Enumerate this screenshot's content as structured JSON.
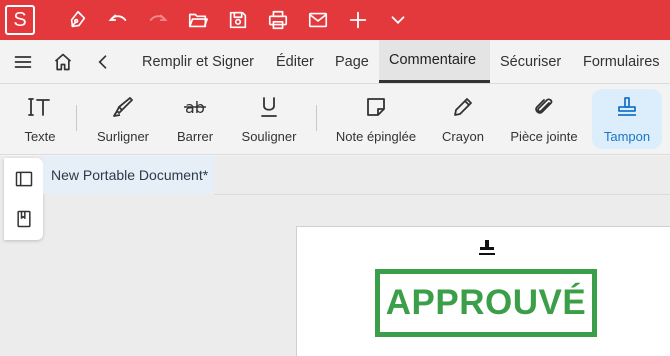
{
  "app": {
    "logo_letter": "S",
    "brand_color": "#e3383c",
    "accent_color": "#1976c8",
    "stamp_color": "#3b9e48"
  },
  "quick_access": [
    "pen-icon",
    "undo-icon",
    "redo-icon",
    "open-folder-icon",
    "save-icon",
    "print-icon",
    "mail-icon",
    "add-icon",
    "chevron-down-icon"
  ],
  "nav": {
    "tabs": [
      {
        "label": "Remplir et Signer"
      },
      {
        "label": "Éditer"
      },
      {
        "label": "Page"
      },
      {
        "label": "Commentaire",
        "active": true
      },
      {
        "label": "Sécuriser"
      },
      {
        "label": "Formulaires"
      }
    ]
  },
  "ribbon": {
    "tools": [
      {
        "label": "Texte",
        "icon": "text-tool-icon"
      },
      {
        "label": "Surligner",
        "icon": "highlighter-icon"
      },
      {
        "label": "Barrer",
        "icon": "strikethrough-icon"
      },
      {
        "label": "Souligner",
        "icon": "underline-icon"
      },
      {
        "label": "Note épinglée",
        "icon": "sticky-note-icon"
      },
      {
        "label": "Crayon",
        "icon": "pencil-icon"
      },
      {
        "label": "Pièce jointe",
        "icon": "paperclip-icon"
      },
      {
        "label": "Tampon",
        "icon": "stamp-icon",
        "selected": true
      }
    ]
  },
  "document": {
    "tab_title": "New Portable Document*",
    "stamp_text": "APPROUVÉ"
  }
}
